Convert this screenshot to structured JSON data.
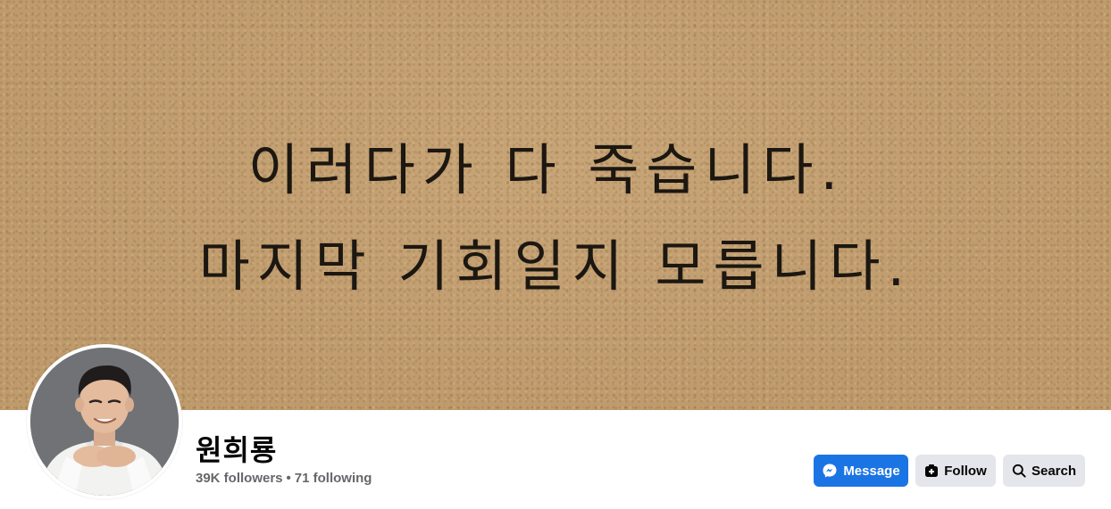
{
  "cover": {
    "line1": "이러다가 다 죽습니다.",
    "line2": "마지막 기회일지 모릅니다."
  },
  "profile": {
    "name": "원희룡",
    "followers": "39K followers",
    "separator": "•",
    "following": "71 following"
  },
  "actions": {
    "message_label": "Message",
    "follow_label": "Follow",
    "search_label": "Search"
  },
  "colors": {
    "primary": "#1b74e4",
    "secondary_button": "#e4e6eb",
    "muted_text": "#65676b",
    "cover": "#c19d6e"
  },
  "icons": {
    "message": "messenger-icon",
    "follow": "follow-icon",
    "search": "search-icon"
  }
}
